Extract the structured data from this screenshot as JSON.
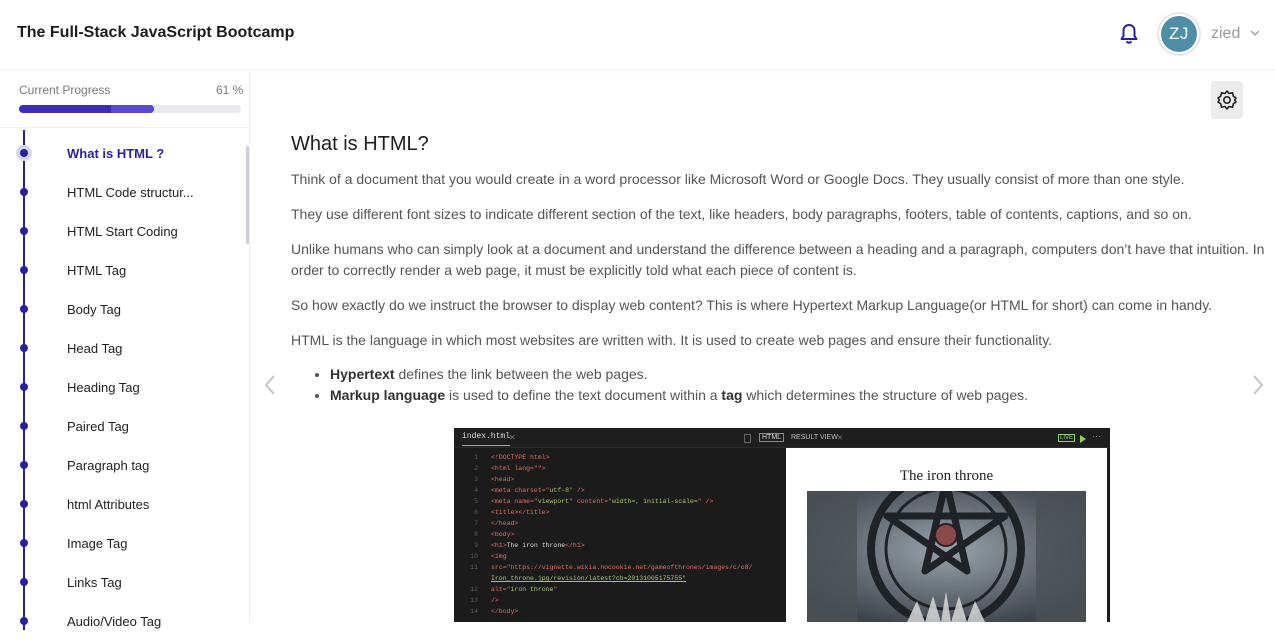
{
  "header": {
    "title": "The Full-Stack JavaScript Bootcamp",
    "avatar_initials": "ZJ",
    "username": "zied",
    "avatar_color": "#4f8fa6"
  },
  "sidebar": {
    "progress_label": "Current Progress",
    "progress_value_text": "61 %",
    "progress_fraction": 0.61,
    "lessons": [
      {
        "label": "What is HTML ?",
        "active": true
      },
      {
        "label": "HTML Code structur..."
      },
      {
        "label": "HTML Start Coding"
      },
      {
        "label": "HTML Tag"
      },
      {
        "label": "Body Tag"
      },
      {
        "label": "Head Tag"
      },
      {
        "label": "Heading Tag"
      },
      {
        "label": "Paired Tag"
      },
      {
        "label": "Paragraph tag"
      },
      {
        "label": "html Attributes"
      },
      {
        "label": "Image Tag"
      },
      {
        "label": "Links Tag"
      },
      {
        "label": "Audio/Video Tag"
      }
    ],
    "accent_color": "#2a1fa0"
  },
  "main": {
    "heading": "What is HTML?",
    "paragraphs": [
      "Think of a document that you would create in a word processor like Microsoft Word or Google Docs. They usually consist of more than one style.",
      "They use different font sizes to indicate different section of the text, like headers, body paragraphs, footers, table of contents, captions, and so on.",
      "Unlike humans who can simply look at a document and understand the difference between a heading and a paragraph, computers don’t have that intuition. In order to correctly render a web page, it must be explicitly told what each piece of content is.",
      "So how exactly do we instruct the browser to display web content? This is where Hypertext Markup Language(or HTML for short) can come in handy.",
      "HTML is the language in which most websites are written with. It is used to create web pages and ensure their functionality."
    ],
    "bullets": [
      {
        "bold": "Hypertext",
        "rest": " defines the link between the web pages."
      },
      {
        "bold": "Markup language",
        "mid": " is used to define the text document within a ",
        "bold2": "tag",
        "rest": " which determines the structure of web pages."
      }
    ]
  },
  "code_image": {
    "file_tab": "index.html",
    "html_tag": "HTML",
    "result_tab": "RESULT VIEW",
    "live_tag": "LIVE",
    "preview_title": "The iron throne",
    "line_numbers": [
      "1",
      "2",
      "3",
      "4",
      "5",
      "6",
      "7",
      "8",
      "9",
      "10",
      "11",
      "",
      "12",
      "13",
      "14"
    ],
    "code": [
      "<!DOCTYPE html>",
      "<html lang=\"\">",
      "  <head>",
      "    <meta charset=\"utf-8\" />",
      "    <meta name=\"viewport\" content=\"width=, initial-scale=\" />",
      "    <title></title>",
      "  </head>",
      "  <body>",
      "    <h1>The iron throne</h1>",
      "    <img",
      "      src=\"https://vignette.wikia.nocookie.net/gameofthrones/images/c/c8/",
      "Iron_throne.jpg/revision/latest?cb=20131005175755\"",
      "      alt=\"iron throne\"",
      "    />",
      "  </body>"
    ]
  }
}
